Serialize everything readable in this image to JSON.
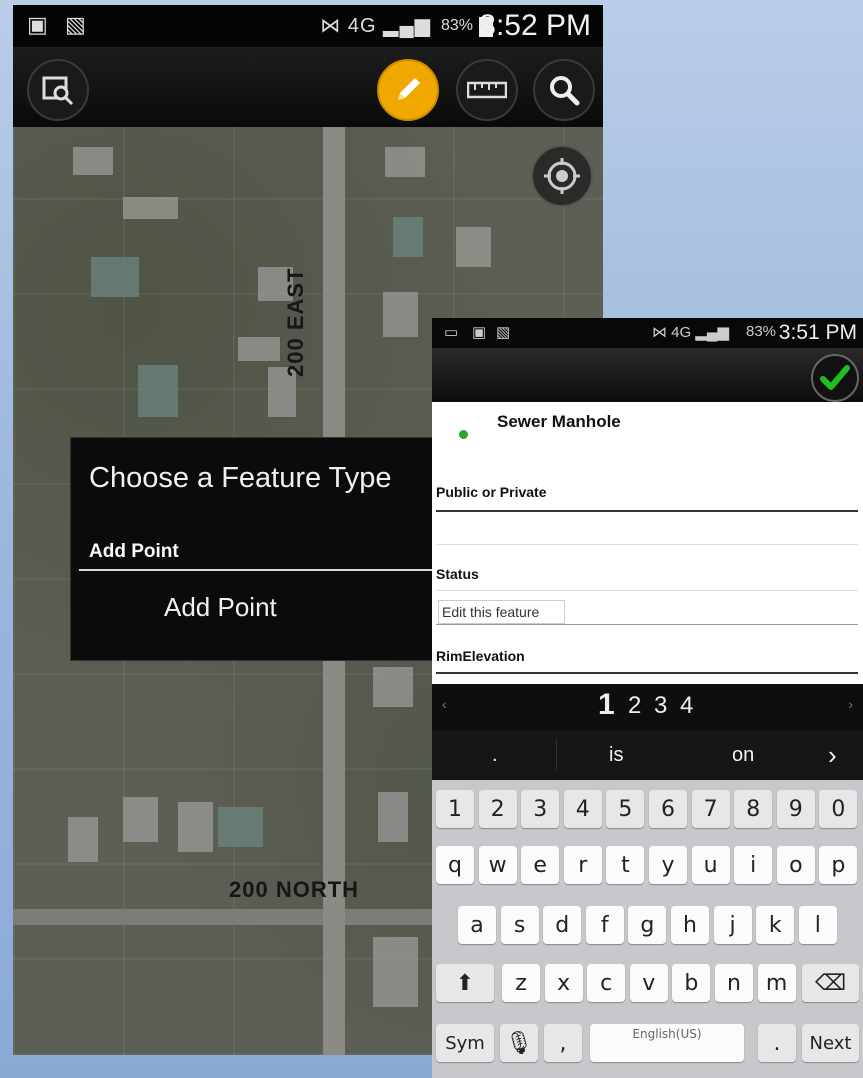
{
  "phone1": {
    "status": {
      "battery": "83%",
      "clock": "3:52 PM"
    },
    "toolbar": {
      "icons": [
        "map-search-icon",
        "pencil-icon",
        "ruler-icon",
        "search-icon"
      ],
      "active_color": "#f0a800"
    },
    "map": {
      "street_vertical": "200 EAST",
      "street_horizontal": "200 NORTH"
    },
    "dialog": {
      "title": "Choose a Feature Type",
      "section": "Add Point",
      "item": "Add Point"
    }
  },
  "phone2": {
    "status": {
      "battery": "83%",
      "clock": "3:51 PM"
    },
    "accept_icon": "check-icon",
    "form": {
      "feature_name": "Sewer Manhole",
      "symbol_color": "#2aa52a",
      "fields": [
        {
          "label": "Public or Private",
          "value": ""
        },
        {
          "label": "Status",
          "value": "Edit this feature"
        },
        {
          "label": "RimElevation",
          "value": ""
        }
      ]
    },
    "keyboard": {
      "pages": [
        "1",
        "2",
        "3",
        "4"
      ],
      "suggestions": [
        ".",
        "is",
        "on"
      ],
      "number_row": [
        "1",
        "2",
        "3",
        "4",
        "5",
        "6",
        "7",
        "8",
        "9",
        "0"
      ],
      "row1": [
        "q",
        "w",
        "e",
        "r",
        "t",
        "y",
        "u",
        "i",
        "o",
        "p"
      ],
      "row2": [
        "a",
        "s",
        "d",
        "f",
        "g",
        "h",
        "j",
        "k",
        "l"
      ],
      "row3": [
        "z",
        "x",
        "c",
        "v",
        "b",
        "n",
        "m"
      ],
      "bottom": {
        "sym": "Sym",
        "comma": ",",
        "space": "English(US)",
        "period": ".",
        "next": "Next"
      }
    }
  }
}
